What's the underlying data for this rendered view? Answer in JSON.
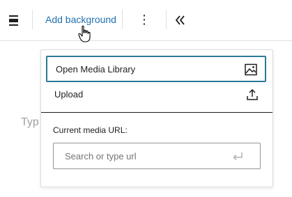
{
  "toolbar": {
    "add_background_label": "Add background",
    "more_options_glyph": "⋮"
  },
  "editor": {
    "placeholder_fragment": "Typ"
  },
  "popover": {
    "open_media_library_label": "Open Media Library",
    "upload_label": "Upload",
    "current_url_label": "Current media URL:",
    "url_input_placeholder": "Search or type url",
    "url_input_value": ""
  },
  "icons": {
    "align": "align-icon",
    "more": "more-vertical-icon",
    "collapse": "chevron-double-left-icon",
    "cursor": "hand-pointer-icon",
    "media": "image-icon",
    "upload": "upload-icon",
    "submit": "enter-icon"
  },
  "colors": {
    "link": "#2271b1",
    "focus_ring": "#2a7a99",
    "border": "#dcdcde",
    "muted_text": "#a0a0a0"
  }
}
